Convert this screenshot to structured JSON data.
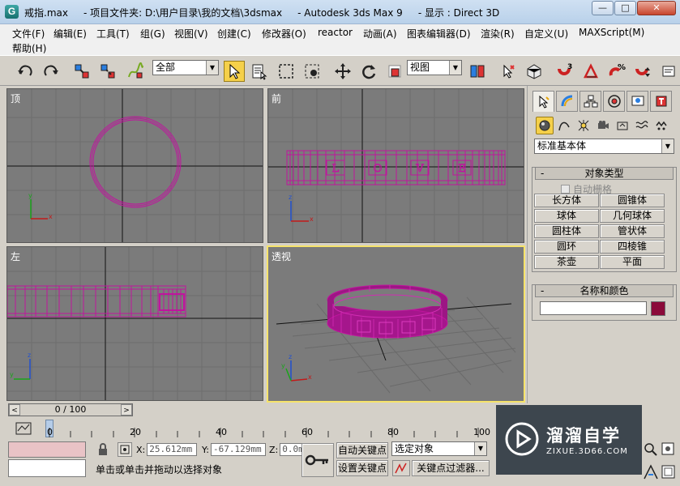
{
  "window": {
    "title": "戒指.max     - 项目文件夹: D:\\用户目录\\我的文档\\3dsmax     - Autodesk 3ds Max 9     - 显示 : Direct 3D",
    "app_icon_letter": "G",
    "btn_minimize": "—",
    "btn_maximize": "□",
    "btn_close": "✕"
  },
  "menu": {
    "items": [
      "文件(F)",
      "编辑(E)",
      "工具(T)",
      "组(G)",
      "视图(V)",
      "创建(C)",
      "修改器(O)",
      "reactor",
      "动画(A)",
      "图表编辑器(D)",
      "渲染(R)",
      "自定义(U)",
      "MAXScript(M)",
      "帮助(H)"
    ]
  },
  "toolbar": {
    "selection_filter": "全部",
    "reference_coord": "视图",
    "snap_labels": [
      "3",
      "%"
    ]
  },
  "viewports": {
    "top": "顶",
    "front": "前",
    "left": "左",
    "perspective": "透视",
    "ring_letters": [
      "L",
      "O",
      "V",
      "E"
    ],
    "axis_x": "x",
    "axis_y": "y",
    "axis_z": "z"
  },
  "command_panel": {
    "category": "标准基本体",
    "object_type_title": "对象类型",
    "autogrid_label": "自动栅格",
    "object_buttons": [
      "长方体",
      "圆锥体",
      "球体",
      "几何球体",
      "圆柱体",
      "管状体",
      "圆环",
      "四棱锥",
      "茶壶",
      "平面"
    ],
    "name_color_title": "名称和颜色",
    "object_color": "#8b0a3a",
    "rollout_minus": "-"
  },
  "timeline": {
    "frame_label": "0 / 100",
    "ticks": [
      "0",
      "20",
      "40",
      "60",
      "80",
      "100"
    ],
    "prev_arrow": "<",
    "next_arrow": ">"
  },
  "status": {
    "x_label": "X:",
    "x_value": "25.612mm",
    "y_label": "Y:",
    "y_value": "-67.129mm",
    "z_label": "Z:",
    "z_value": "0.0m",
    "auto_key": "自动关键点",
    "set_key": "设置关键点",
    "key_mode": "选定对象",
    "key_filters": "关键点过滤器...",
    "prompt": "单击或单击并拖动以选择对象"
  },
  "watermark": {
    "title": "溜溜自学",
    "url": "ZIXUE.3D66.COM"
  },
  "colors": {
    "wire": "#c0149e",
    "active_viewport": "#f6e36a",
    "viewport_bg": "#7b7b7b"
  }
}
